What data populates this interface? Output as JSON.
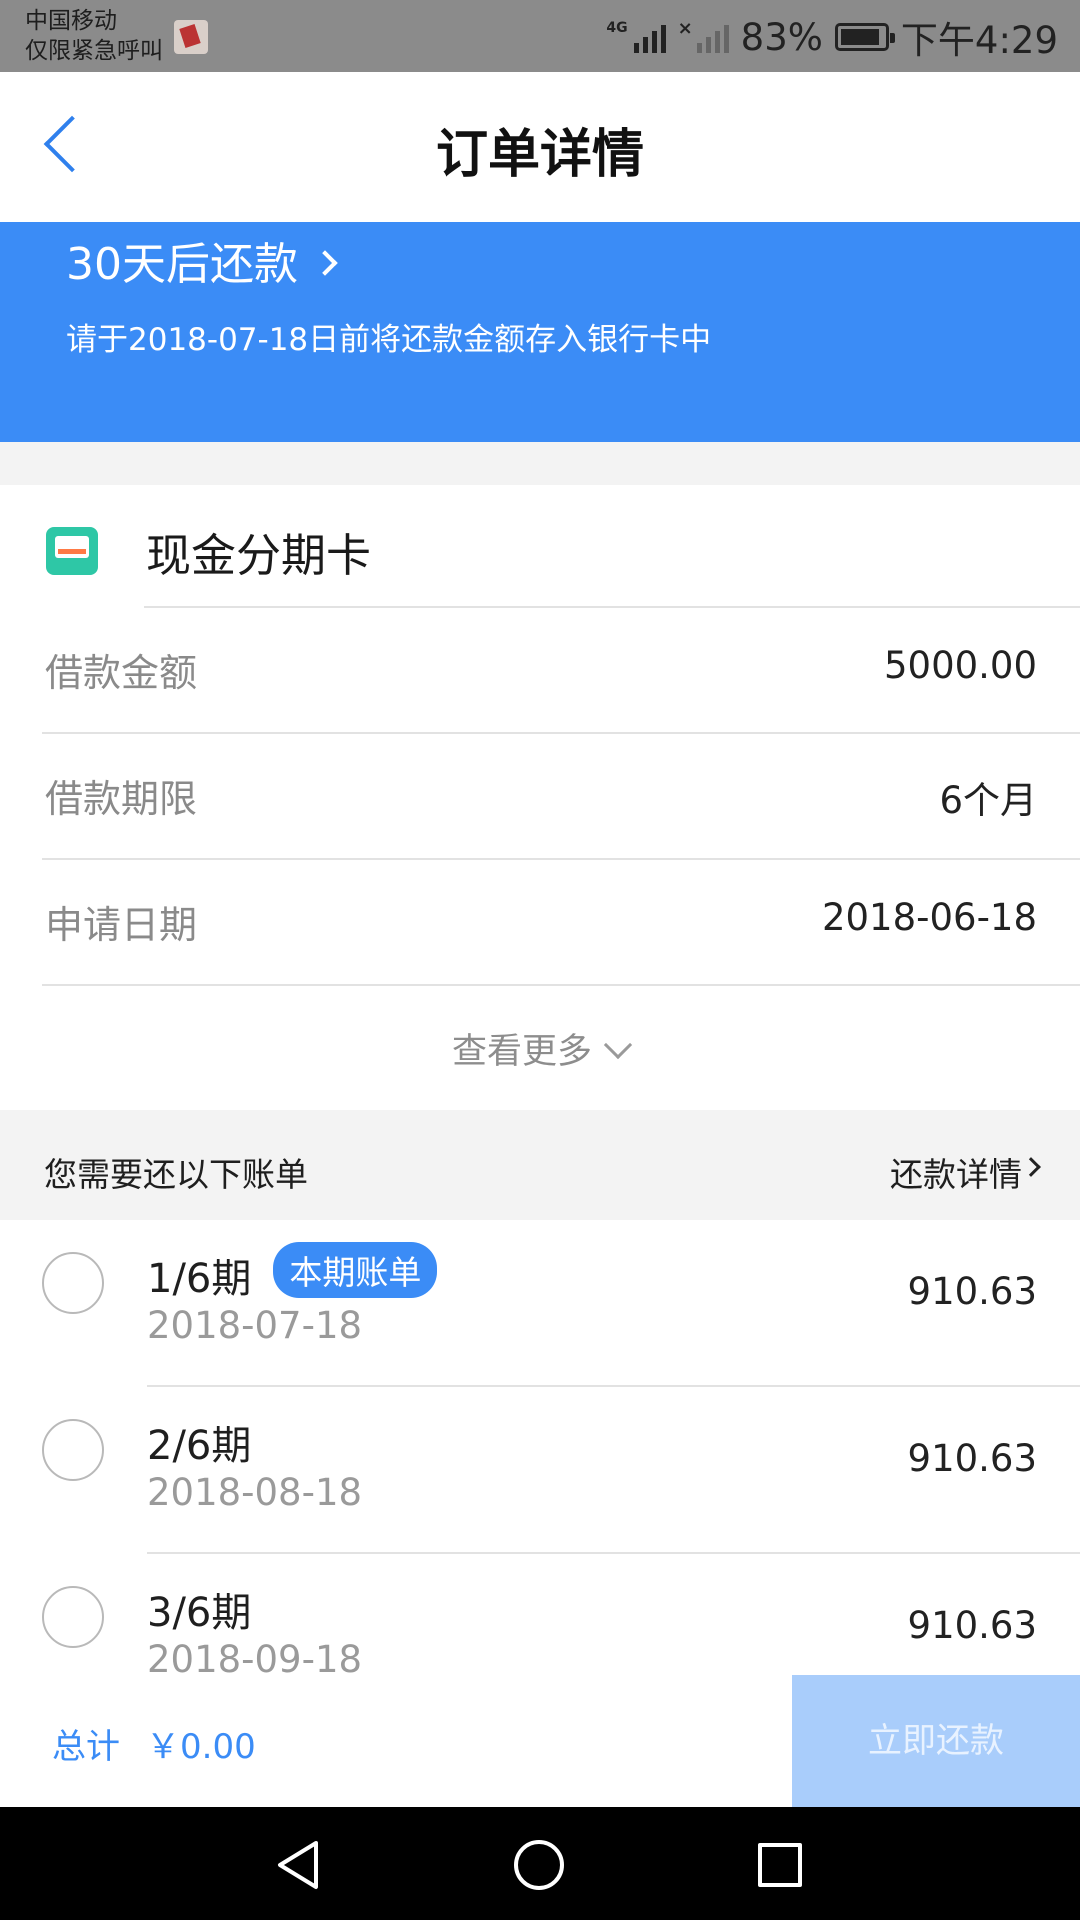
{
  "status_bar": {
    "carrier": "中国移动",
    "emergency": "仅限紧急呼叫",
    "network": "4G",
    "battery": "83%",
    "time": "下午4:29"
  },
  "header": {
    "title": "订单详情"
  },
  "banner": {
    "title": "30天后还款",
    "subtitle": "请于2018-07-18日前将还款金额存入银行卡中"
  },
  "product": {
    "name": "现金分期卡",
    "icon": "card-icon"
  },
  "info_rows": [
    {
      "label": "借款金额",
      "value": "5000.00"
    },
    {
      "label": "借款期限",
      "value": "6个月"
    },
    {
      "label": "申请日期",
      "value": "2018-06-18"
    }
  ],
  "more_label": "查看更多",
  "bills_header": {
    "title": "您需要还以下账单",
    "detail_link": "还款详情"
  },
  "bills": [
    {
      "period": "1/6期",
      "tag": "本期账单",
      "date": "2018-07-18",
      "amount": "910.63"
    },
    {
      "period": "2/6期",
      "tag": "",
      "date": "2018-08-18",
      "amount": "910.63"
    },
    {
      "period": "3/6期",
      "tag": "",
      "date": "2018-09-18",
      "amount": "910.63"
    }
  ],
  "footer": {
    "total_label": "总计",
    "total_value": "￥0.00",
    "pay_button": "立即还款"
  },
  "colors": {
    "accent": "#3b8cf6",
    "pay_button_disabled": "#a9cdfb",
    "status_bar": "#8b8b8b"
  }
}
